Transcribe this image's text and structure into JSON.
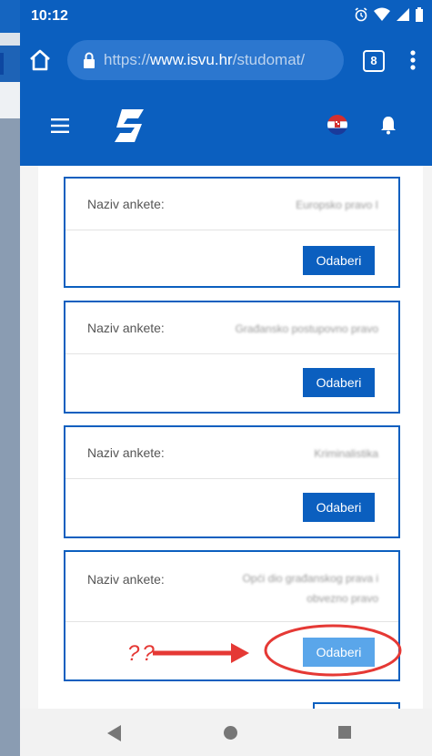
{
  "status": {
    "time": "10:12"
  },
  "browser": {
    "url_prefix": "https://",
    "url_host": "www.isvu.hr",
    "url_path": "/studomat/",
    "tab_count": "8"
  },
  "app": {
    "flag": "croatia-flag-icon"
  },
  "cards": [
    {
      "label": "Naziv ankete:",
      "value_line1": "Europsko pravo I",
      "value_line2": "",
      "button": "Odaberi"
    },
    {
      "label": "Naziv ankete:",
      "value_line1": "Građansko postupovno pravo",
      "value_line2": "",
      "button": "Odaberi"
    },
    {
      "label": "Naziv ankete:",
      "value_line1": "Kriminalistika",
      "value_line2": "",
      "button": "Odaberi"
    },
    {
      "label": "Naziv ankete:",
      "value_line1": "Opći dio građanskog prava i",
      "value_line2": "obvezno pravo",
      "button": "Odaberi"
    }
  ],
  "annotation": {
    "text": "??"
  },
  "colors": {
    "primary": "#0b5fbf",
    "annotation": "#e53935",
    "button_disabled": "#5aa6ea"
  }
}
